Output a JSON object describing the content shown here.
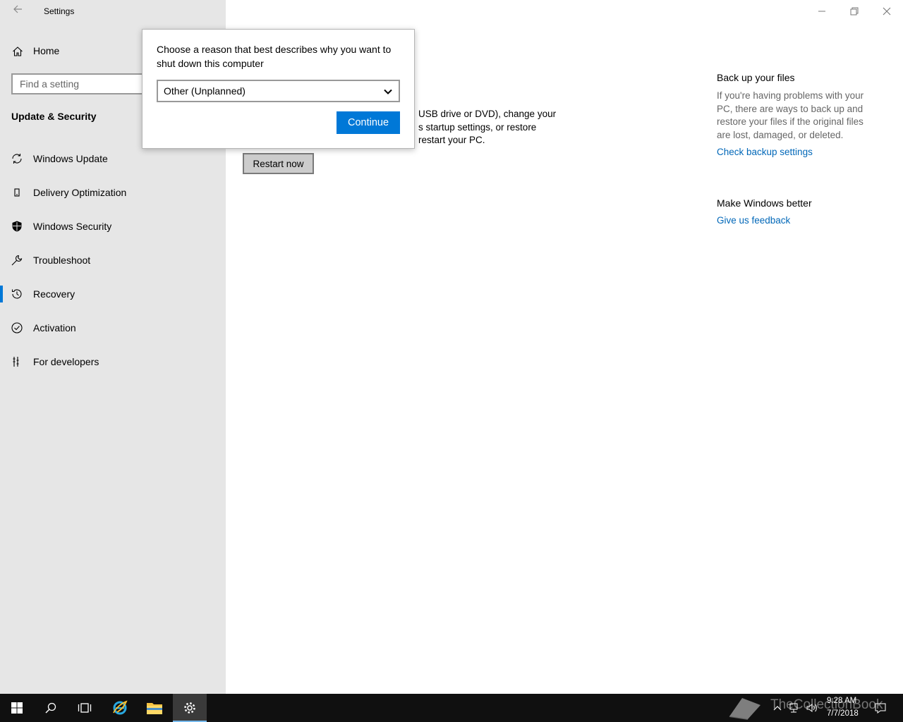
{
  "window": {
    "title": "Settings"
  },
  "sidebar": {
    "home_label": "Home",
    "search_placeholder": "Find a setting",
    "section_title": "Update & Security",
    "items": [
      {
        "label": "Windows Update",
        "icon": "sync-icon"
      },
      {
        "label": "Delivery Optimization",
        "icon": "delivery-optimization-icon"
      },
      {
        "label": "Windows Security",
        "icon": "shield-icon"
      },
      {
        "label": "Troubleshoot",
        "icon": "wrench-icon"
      },
      {
        "label": "Recovery",
        "icon": "history-icon",
        "active": true
      },
      {
        "label": "Activation",
        "icon": "check-circle-icon"
      },
      {
        "label": "For developers",
        "icon": "developer-tools-icon"
      }
    ]
  },
  "main": {
    "desc_line1": "USB drive or DVD), change your",
    "desc_line2": "s startup settings, or restore",
    "desc_line3": "restart your PC.",
    "restart_label": "Restart now"
  },
  "right": {
    "backup_heading": "Back up your files",
    "backup_text": "If you're having problems with your PC, there are ways to back up and restore your files if the original files are lost, damaged, or deleted.",
    "backup_link": "Check backup settings",
    "better_heading": "Make Windows better",
    "feedback_link": "Give us feedback"
  },
  "dialog": {
    "prompt": "Choose a reason that best describes why you want to shut down this computer",
    "selected_reason": "Other (Unplanned)",
    "continue_label": "Continue"
  },
  "taskbar": {
    "time": "9:28 AM",
    "date": "7/7/2018",
    "watermark": "TheCollectionBook"
  },
  "colors": {
    "accent": "#0078d7",
    "link": "#0067b8",
    "sidebar_bg": "#e6e6e6",
    "taskbar_bg": "#101010"
  }
}
